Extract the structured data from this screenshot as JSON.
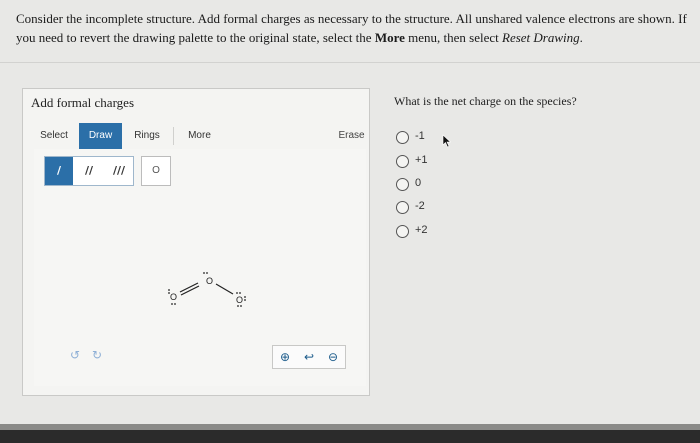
{
  "question": {
    "text_1": "Consider the incomplete structure. Add formal charges as necessary to the structure. All unshared valence electrons are shown. If you need to revert the drawing palette to the original state, select the ",
    "bold": "More",
    "text_2": " menu, then select ",
    "italic": "Reset Drawing",
    "text_3": "."
  },
  "panel": {
    "title": "Add formal charges",
    "toolbar": {
      "select": "Select",
      "draw": "Draw",
      "rings": "Rings",
      "more": "More",
      "erase": "Erase"
    },
    "bonds": [
      "/",
      "//",
      "///"
    ],
    "atom_button": "O",
    "undo_icon": "undo-icon",
    "redo_icon": "redo-icon",
    "zoom": [
      "zoom-in-icon",
      "zoom-reset-icon",
      "zoom-out-icon"
    ]
  },
  "molecule": {
    "atoms": [
      "O",
      "O",
      "O"
    ]
  },
  "side": {
    "question": "What is the net charge on the species?",
    "options": [
      "-1",
      "+1",
      "0",
      "-2",
      "+2"
    ]
  },
  "colors": {
    "accent": "#2b6fa8"
  }
}
